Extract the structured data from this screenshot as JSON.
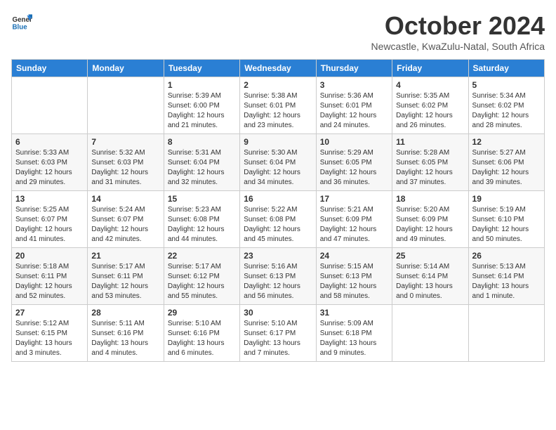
{
  "logo": {
    "line1": "General",
    "line2": "Blue"
  },
  "title": "October 2024",
  "location": "Newcastle, KwaZulu-Natal, South Africa",
  "weekdays": [
    "Sunday",
    "Monday",
    "Tuesday",
    "Wednesday",
    "Thursday",
    "Friday",
    "Saturday"
  ],
  "weeks": [
    [
      {
        "day": "",
        "info": ""
      },
      {
        "day": "",
        "info": ""
      },
      {
        "day": "1",
        "info": "Sunrise: 5:39 AM\nSunset: 6:00 PM\nDaylight: 12 hours\nand 21 minutes."
      },
      {
        "day": "2",
        "info": "Sunrise: 5:38 AM\nSunset: 6:01 PM\nDaylight: 12 hours\nand 23 minutes."
      },
      {
        "day": "3",
        "info": "Sunrise: 5:36 AM\nSunset: 6:01 PM\nDaylight: 12 hours\nand 24 minutes."
      },
      {
        "day": "4",
        "info": "Sunrise: 5:35 AM\nSunset: 6:02 PM\nDaylight: 12 hours\nand 26 minutes."
      },
      {
        "day": "5",
        "info": "Sunrise: 5:34 AM\nSunset: 6:02 PM\nDaylight: 12 hours\nand 28 minutes."
      }
    ],
    [
      {
        "day": "6",
        "info": "Sunrise: 5:33 AM\nSunset: 6:03 PM\nDaylight: 12 hours\nand 29 minutes."
      },
      {
        "day": "7",
        "info": "Sunrise: 5:32 AM\nSunset: 6:03 PM\nDaylight: 12 hours\nand 31 minutes."
      },
      {
        "day": "8",
        "info": "Sunrise: 5:31 AM\nSunset: 6:04 PM\nDaylight: 12 hours\nand 32 minutes."
      },
      {
        "day": "9",
        "info": "Sunrise: 5:30 AM\nSunset: 6:04 PM\nDaylight: 12 hours\nand 34 minutes."
      },
      {
        "day": "10",
        "info": "Sunrise: 5:29 AM\nSunset: 6:05 PM\nDaylight: 12 hours\nand 36 minutes."
      },
      {
        "day": "11",
        "info": "Sunrise: 5:28 AM\nSunset: 6:05 PM\nDaylight: 12 hours\nand 37 minutes."
      },
      {
        "day": "12",
        "info": "Sunrise: 5:27 AM\nSunset: 6:06 PM\nDaylight: 12 hours\nand 39 minutes."
      }
    ],
    [
      {
        "day": "13",
        "info": "Sunrise: 5:25 AM\nSunset: 6:07 PM\nDaylight: 12 hours\nand 41 minutes."
      },
      {
        "day": "14",
        "info": "Sunrise: 5:24 AM\nSunset: 6:07 PM\nDaylight: 12 hours\nand 42 minutes."
      },
      {
        "day": "15",
        "info": "Sunrise: 5:23 AM\nSunset: 6:08 PM\nDaylight: 12 hours\nand 44 minutes."
      },
      {
        "day": "16",
        "info": "Sunrise: 5:22 AM\nSunset: 6:08 PM\nDaylight: 12 hours\nand 45 minutes."
      },
      {
        "day": "17",
        "info": "Sunrise: 5:21 AM\nSunset: 6:09 PM\nDaylight: 12 hours\nand 47 minutes."
      },
      {
        "day": "18",
        "info": "Sunrise: 5:20 AM\nSunset: 6:09 PM\nDaylight: 12 hours\nand 49 minutes."
      },
      {
        "day": "19",
        "info": "Sunrise: 5:19 AM\nSunset: 6:10 PM\nDaylight: 12 hours\nand 50 minutes."
      }
    ],
    [
      {
        "day": "20",
        "info": "Sunrise: 5:18 AM\nSunset: 6:11 PM\nDaylight: 12 hours\nand 52 minutes."
      },
      {
        "day": "21",
        "info": "Sunrise: 5:17 AM\nSunset: 6:11 PM\nDaylight: 12 hours\nand 53 minutes."
      },
      {
        "day": "22",
        "info": "Sunrise: 5:17 AM\nSunset: 6:12 PM\nDaylight: 12 hours\nand 55 minutes."
      },
      {
        "day": "23",
        "info": "Sunrise: 5:16 AM\nSunset: 6:13 PM\nDaylight: 12 hours\nand 56 minutes."
      },
      {
        "day": "24",
        "info": "Sunrise: 5:15 AM\nSunset: 6:13 PM\nDaylight: 12 hours\nand 58 minutes."
      },
      {
        "day": "25",
        "info": "Sunrise: 5:14 AM\nSunset: 6:14 PM\nDaylight: 13 hours\nand 0 minutes."
      },
      {
        "day": "26",
        "info": "Sunrise: 5:13 AM\nSunset: 6:14 PM\nDaylight: 13 hours\nand 1 minute."
      }
    ],
    [
      {
        "day": "27",
        "info": "Sunrise: 5:12 AM\nSunset: 6:15 PM\nDaylight: 13 hours\nand 3 minutes."
      },
      {
        "day": "28",
        "info": "Sunrise: 5:11 AM\nSunset: 6:16 PM\nDaylight: 13 hours\nand 4 minutes."
      },
      {
        "day": "29",
        "info": "Sunrise: 5:10 AM\nSunset: 6:16 PM\nDaylight: 13 hours\nand 6 minutes."
      },
      {
        "day": "30",
        "info": "Sunrise: 5:10 AM\nSunset: 6:17 PM\nDaylight: 13 hours\nand 7 minutes."
      },
      {
        "day": "31",
        "info": "Sunrise: 5:09 AM\nSunset: 6:18 PM\nDaylight: 13 hours\nand 9 minutes."
      },
      {
        "day": "",
        "info": ""
      },
      {
        "day": "",
        "info": ""
      }
    ]
  ]
}
